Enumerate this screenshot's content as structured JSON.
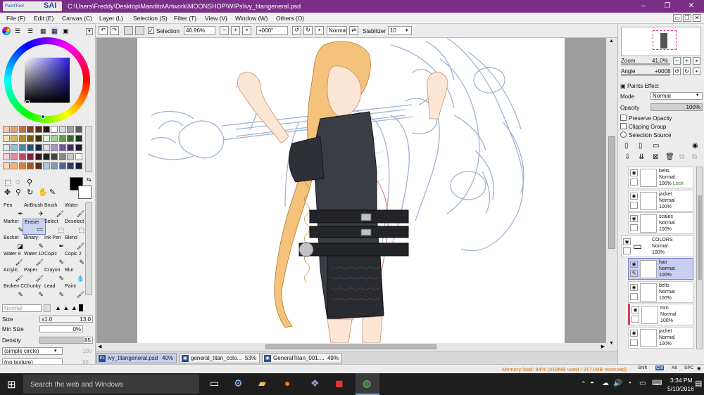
{
  "window": {
    "app_name": "SAI",
    "app_sub": "PaintTool",
    "title": "C:\\Users\\Freddy\\Desktop\\Mandito\\Artwork\\MOONSHOP\\WIPs\\ivy_titangeneral.psd",
    "min": "–",
    "max": "❐",
    "close": "✕"
  },
  "menu": [
    "File (F)",
    "Edit (E)",
    "Canvas (C)",
    "Layer (L)",
    "Selection (S)",
    "Filter (T)",
    "View (V)",
    "Window (W)",
    "Others (O)"
  ],
  "toolbar": {
    "selection_label": "Selection",
    "zoom": "40.96%",
    "rotation": "+000°",
    "blend": "Normal",
    "stabilizer_label": "Stabilizer",
    "stabilizer": "10"
  },
  "tools": [
    {
      "label": "Pen",
      "glyph": "✒"
    },
    {
      "label": "AirBrush",
      "glyph": "✈"
    },
    {
      "label": "Brush",
      "glyph": "🖌"
    },
    {
      "label": "Water",
      "glyph": "🖌"
    },
    {
      "label": "Marker",
      "glyph": "✎"
    },
    {
      "label": "Eraser",
      "glyph": "▭"
    },
    {
      "label": "Select",
      "glyph": "⬚"
    },
    {
      "label": "Deselect",
      "glyph": "⬚"
    },
    {
      "label": "Bucket",
      "glyph": "◪"
    },
    {
      "label": "Binary",
      "glyph": "✎"
    },
    {
      "label": "Ink Pen",
      "glyph": "✒"
    },
    {
      "label": "Blend",
      "glyph": "🖌"
    },
    {
      "label": "Water 9",
      "glyph": "🖌"
    },
    {
      "label": "Water 10",
      "glyph": "🖌"
    },
    {
      "label": "Copic",
      "glyph": "✎"
    },
    {
      "label": "Copic 2",
      "glyph": "✎"
    },
    {
      "label": "Acrylic",
      "glyph": "🖌"
    },
    {
      "label": "Paper",
      "glyph": "🖌"
    },
    {
      "label": "Crayon",
      "glyph": "✎"
    },
    {
      "label": "Blur",
      "glyph": "💧"
    },
    {
      "label": "Broken C",
      "glyph": "✎"
    },
    {
      "label": "Chunky",
      "glyph": "✎"
    },
    {
      "label": "Lead",
      "glyph": "✎"
    },
    {
      "label": "Paint",
      "glyph": "🖌"
    }
  ],
  "brush": {
    "mode": "Normal",
    "size_label": "Size",
    "size_mult": "x1.0",
    "size": "13.0",
    "min_size_label": "Min Size",
    "min_size": "0%",
    "density_label": "Density",
    "density": "85",
    "shape": "(simple circle)",
    "shape_value": "100",
    "texture": "(no texture)",
    "texture_value": "95"
  },
  "navigator": {
    "zoom_label": "Zoom",
    "zoom": "41.0%",
    "angle_label": "Angle",
    "angle": "+0008"
  },
  "layer_panel": {
    "paints_effect": "Paints Effect",
    "mode_label": "Mode",
    "mode": "Normal",
    "opacity_label": "Opacity",
    "opacity": "100%",
    "preserve_opacity": "Preserve Opacity",
    "clipping_group": "Clipping Group",
    "selection_source": "Selection Source"
  },
  "layers": [
    {
      "name": "belts",
      "mode": "Normal",
      "opacity": "100%",
      "extra": "Lock"
    },
    {
      "name": "jacket",
      "mode": "Normal",
      "opacity": "100%",
      "extra": ""
    },
    {
      "name": "scales",
      "mode": "Normal",
      "opacity": "100%",
      "extra": ""
    },
    {
      "name": "COLORS",
      "mode": "Normal",
      "opacity": "100%",
      "extra": ""
    },
    {
      "name": "hair",
      "mode": "Normal",
      "opacity": "100%",
      "extra": ""
    },
    {
      "name": "belts",
      "mode": "Normal",
      "opacity": "100%",
      "extra": ""
    },
    {
      "name": "trim",
      "mode": "Normal",
      "opacity": "100%",
      "extra": ""
    },
    {
      "name": "jacket",
      "mode": "Normal",
      "opacity": "100%",
      "extra": ""
    }
  ],
  "doc_tabs": [
    {
      "name": "ivy_titangeneral.psd",
      "pct": "40%",
      "icon": "Ps"
    },
    {
      "name": "general_titan_colo...",
      "pct": "53%",
      "icon": "▣"
    },
    {
      "name": "GeneralTitan_001....",
      "pct": "49%",
      "icon": "▣"
    }
  ],
  "status": {
    "memory": "Memory load: 84% (418MB used / 2171MB reserved)",
    "keys": [
      "Shift",
      "Ctrl",
      "Alt",
      "SPC",
      "◉",
      "Any"
    ]
  },
  "taskbar": {
    "search_placeholder": "Search the web and Windows",
    "time": "3:34 PM",
    "date": "5/10/2016"
  },
  "colors": {
    "titlebar": "#7a2f86",
    "selected_layer": "#c9cdf2",
    "memory_text": "#d07000"
  }
}
